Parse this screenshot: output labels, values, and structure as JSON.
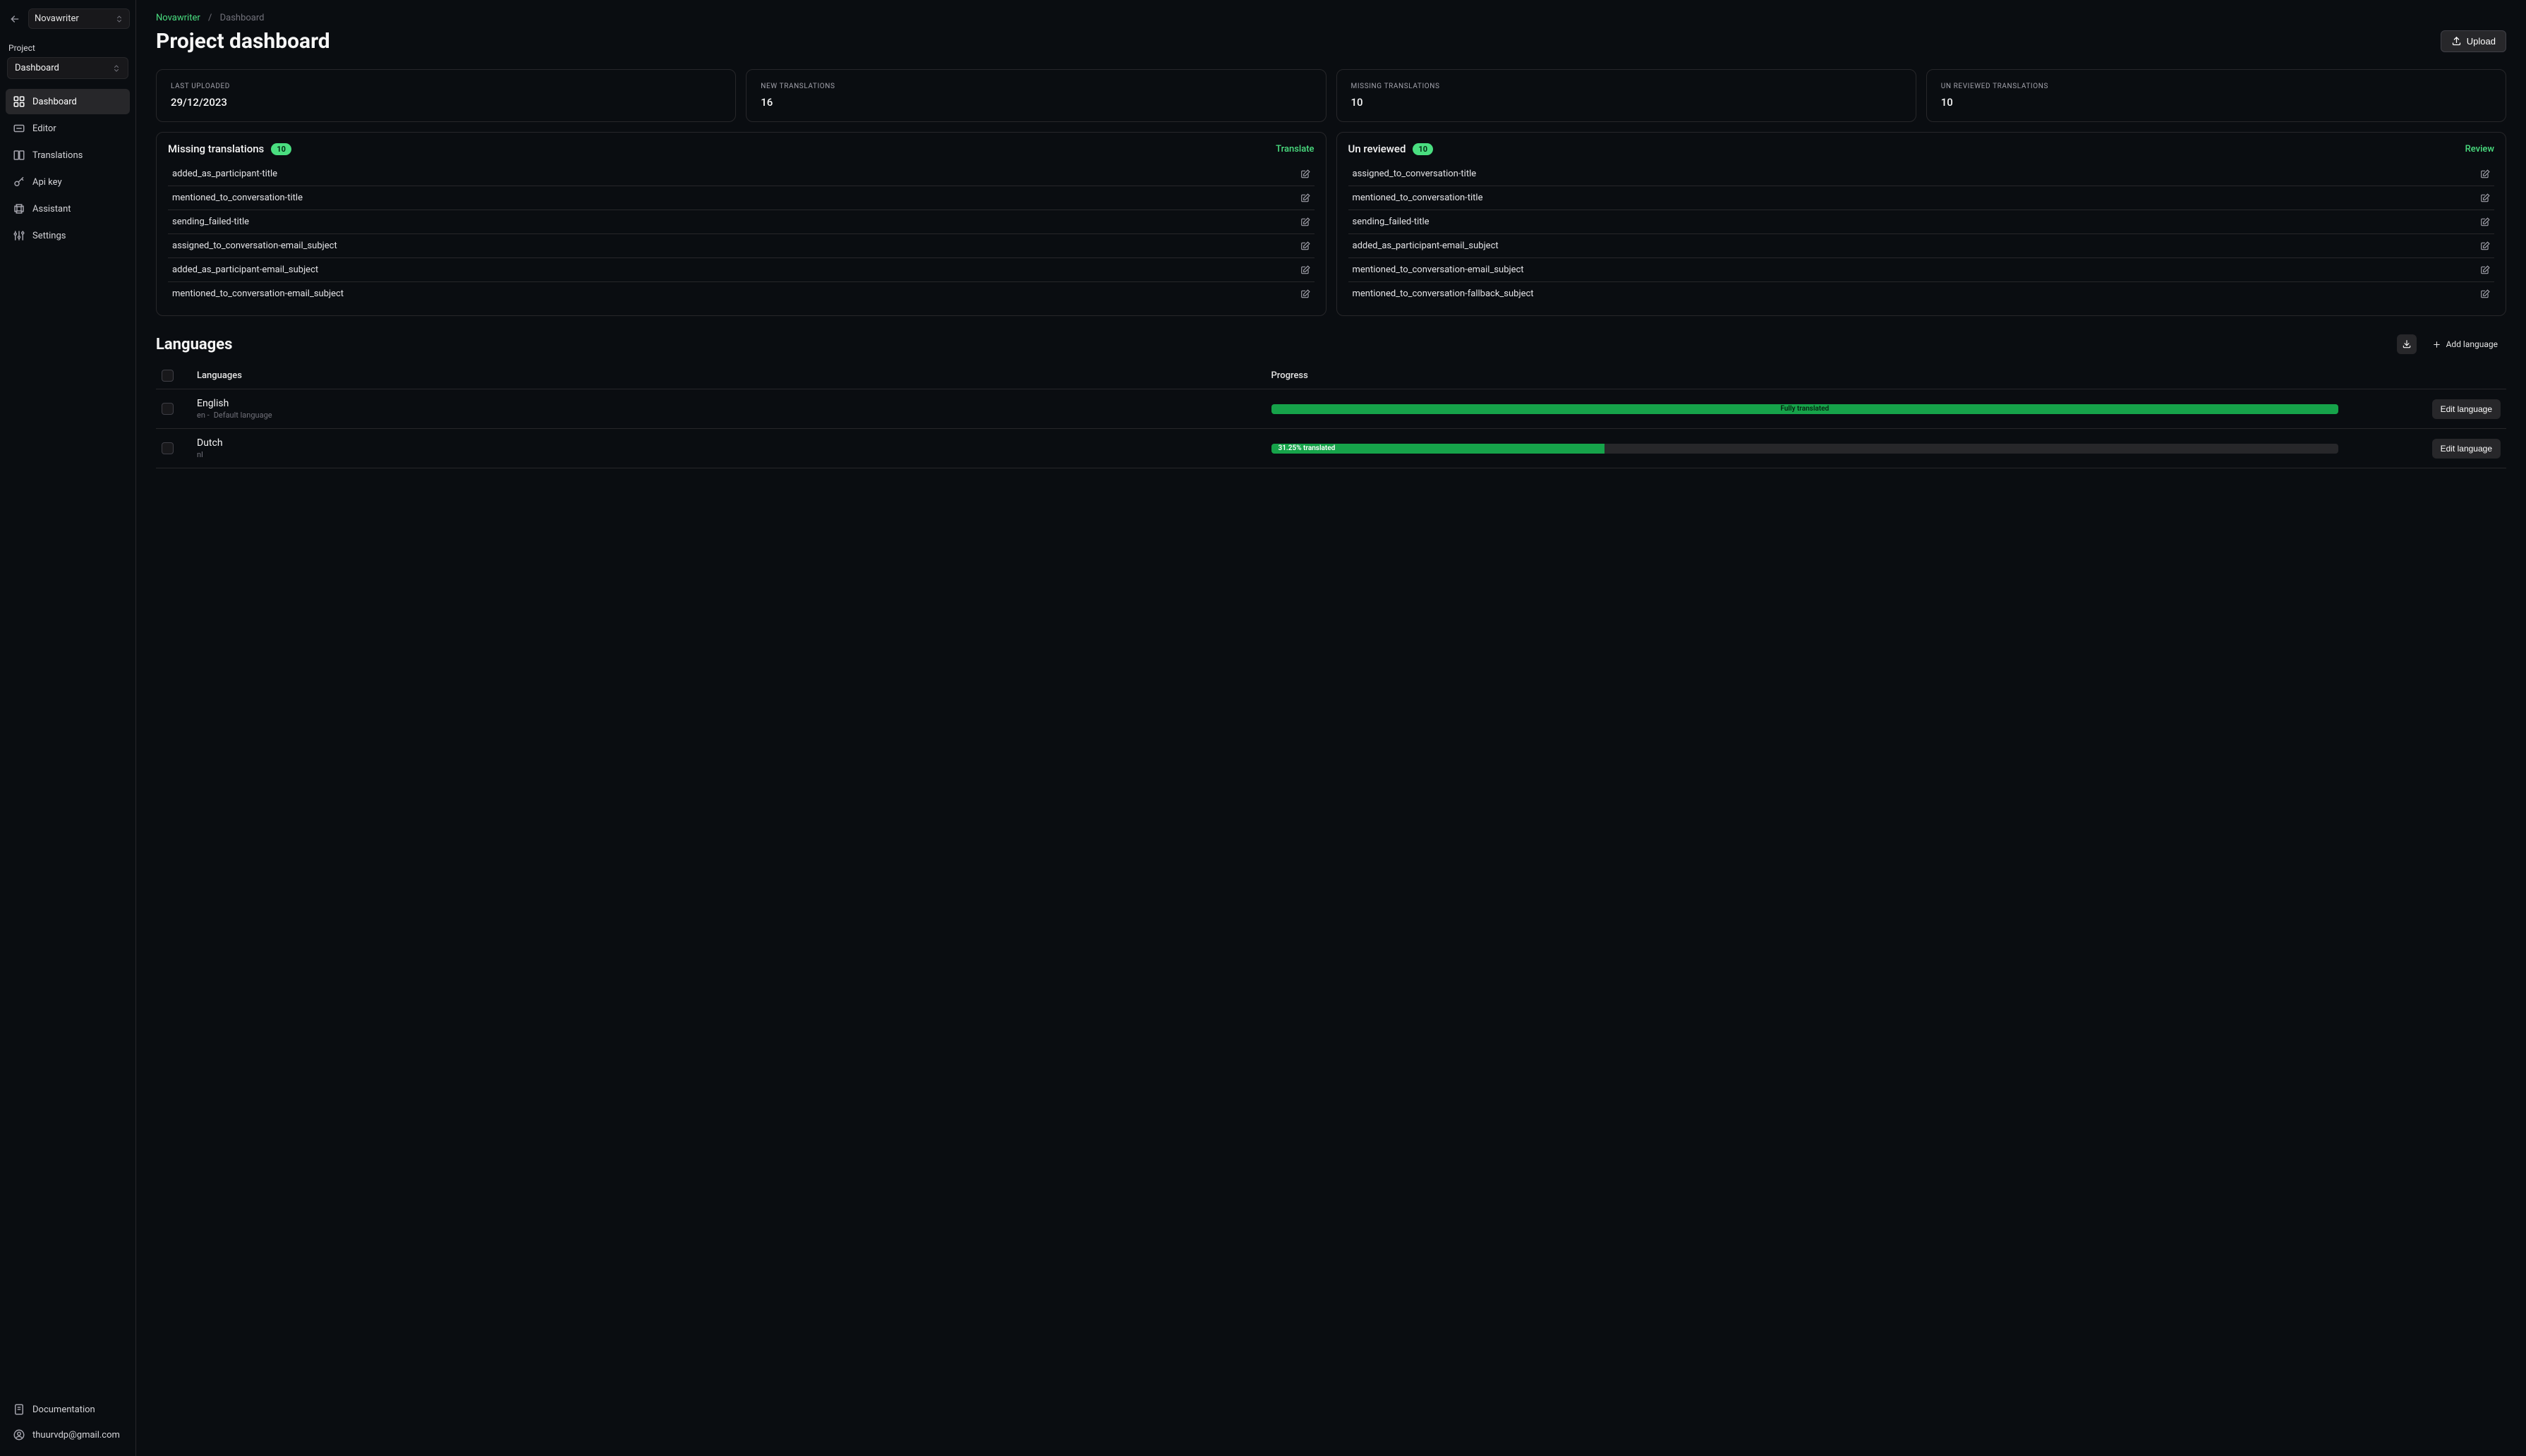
{
  "org_name": "Novawriter",
  "project_label": "Project",
  "project_name": "Dashboard",
  "nav": {
    "dashboard": "Dashboard",
    "editor": "Editor",
    "translations": "Translations",
    "api_key": "Api key",
    "assistant": "Assistant",
    "settings": "Settings",
    "documentation": "Documentation"
  },
  "user_email": "thuurvdp@gmail.com",
  "breadcrumb": {
    "root": "Novawriter",
    "current": "Dashboard"
  },
  "page_title": "Project dashboard",
  "upload_label": "Upload",
  "stats": {
    "last_uploaded": {
      "label": "LAST UPLOADED",
      "value": "29/12/2023"
    },
    "new_translations": {
      "label": "NEW TRANSLATIONS",
      "value": "16"
    },
    "missing_translations": {
      "label": "MISSING TRANSLATIONS",
      "value": "10"
    },
    "unreviewed": {
      "label": "UN REVIEWED TRANSLATIONS",
      "value": "10"
    }
  },
  "missing_panel": {
    "title": "Missing translations",
    "count": "10",
    "action": "Translate",
    "items": [
      "added_as_participant-title",
      "mentioned_to_conversation-title",
      "sending_failed-title",
      "assigned_to_conversation-email_subject",
      "added_as_participant-email_subject",
      "mentioned_to_conversation-email_subject"
    ]
  },
  "unreviewed_panel": {
    "title": "Un reviewed",
    "count": "10",
    "action": "Review",
    "items": [
      "assigned_to_conversation-title",
      "mentioned_to_conversation-title",
      "sending_failed-title",
      "added_as_participant-email_subject",
      "mentioned_to_conversation-email_subject",
      "mentioned_to_conversation-fallback_subject"
    ]
  },
  "languages_section": {
    "title": "Languages",
    "add_label": "Add language",
    "col_languages": "Languages",
    "col_progress": "Progress",
    "edit_label": "Edit language",
    "rows": [
      {
        "name": "English",
        "code": "en",
        "dash": "-",
        "default_text": "Default language",
        "progress_text": "Fully translated",
        "progress_pct": 100
      },
      {
        "name": "Dutch",
        "code": "nl",
        "dash": "",
        "default_text": "",
        "progress_text": "31.25% translated",
        "progress_pct": 31.25
      }
    ]
  }
}
